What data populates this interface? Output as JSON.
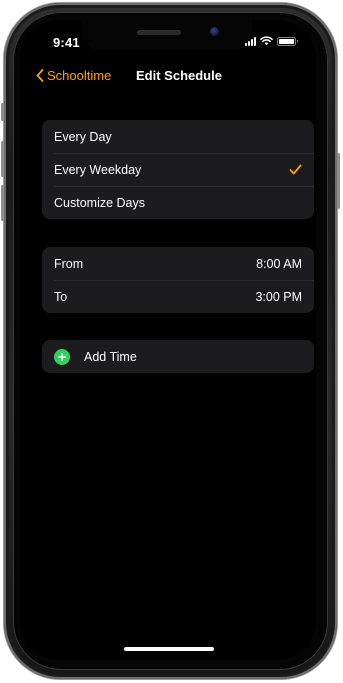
{
  "status_bar": {
    "time": "9:41"
  },
  "nav": {
    "back_label": "Schooltime",
    "title": "Edit Schedule"
  },
  "colors": {
    "accent": "#ff9f0a",
    "add": "#30d158",
    "group_bg": "#1c1c1e",
    "screen_bg": "#000000"
  },
  "days_group": {
    "items": [
      {
        "label": "Every Day",
        "selected": false
      },
      {
        "label": "Every Weekday",
        "selected": true
      },
      {
        "label": "Customize Days",
        "selected": false
      }
    ]
  },
  "time_group": {
    "from_label": "From",
    "from_value": "8:00 AM",
    "to_label": "To",
    "to_value": "3:00 PM"
  },
  "add_time": {
    "label": "Add Time",
    "icon": "plus-circle-icon"
  }
}
